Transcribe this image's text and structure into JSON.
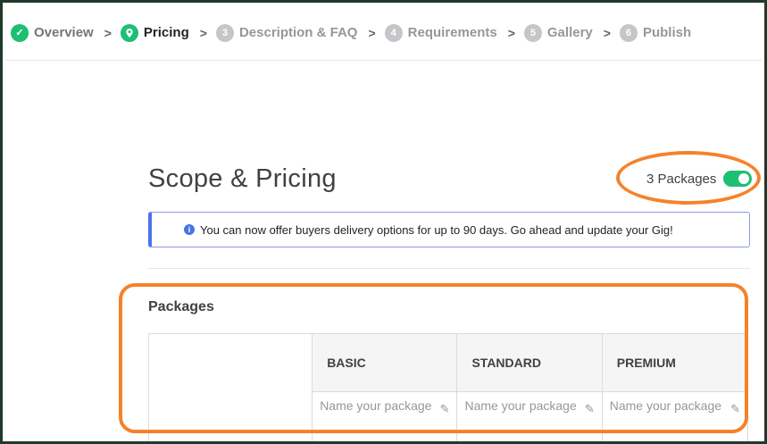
{
  "stepper": {
    "steps": [
      {
        "num": "✓",
        "label": "Overview",
        "state": "done"
      },
      {
        "num": "",
        "label": "Pricing",
        "state": "active"
      },
      {
        "num": "3",
        "label": "Description & FAQ",
        "state": "todo"
      },
      {
        "num": "4",
        "label": "Requirements",
        "state": "todo"
      },
      {
        "num": "5",
        "label": "Gallery",
        "state": "todo"
      },
      {
        "num": "6",
        "label": "Publish",
        "state": "todo"
      }
    ],
    "separator": ">"
  },
  "main": {
    "title": "Scope & Pricing",
    "packages_toggle_label": "3 Packages",
    "packages_toggle_on": true,
    "info_text": "You can now offer buyers delivery options for up to 90 days. Go ahead and update your Gig!",
    "packages_heading": "Packages"
  },
  "table": {
    "columns": [
      {
        "label": "BASIC",
        "placeholder": "Name your package"
      },
      {
        "label": "STANDARD",
        "placeholder": "Name your package"
      },
      {
        "label": "PREMIUM",
        "placeholder": "Name your package"
      }
    ]
  },
  "colors": {
    "accent_green": "#1dbf73",
    "highlight_orange": "#f5822a",
    "info_blue": "#4a73e8"
  }
}
